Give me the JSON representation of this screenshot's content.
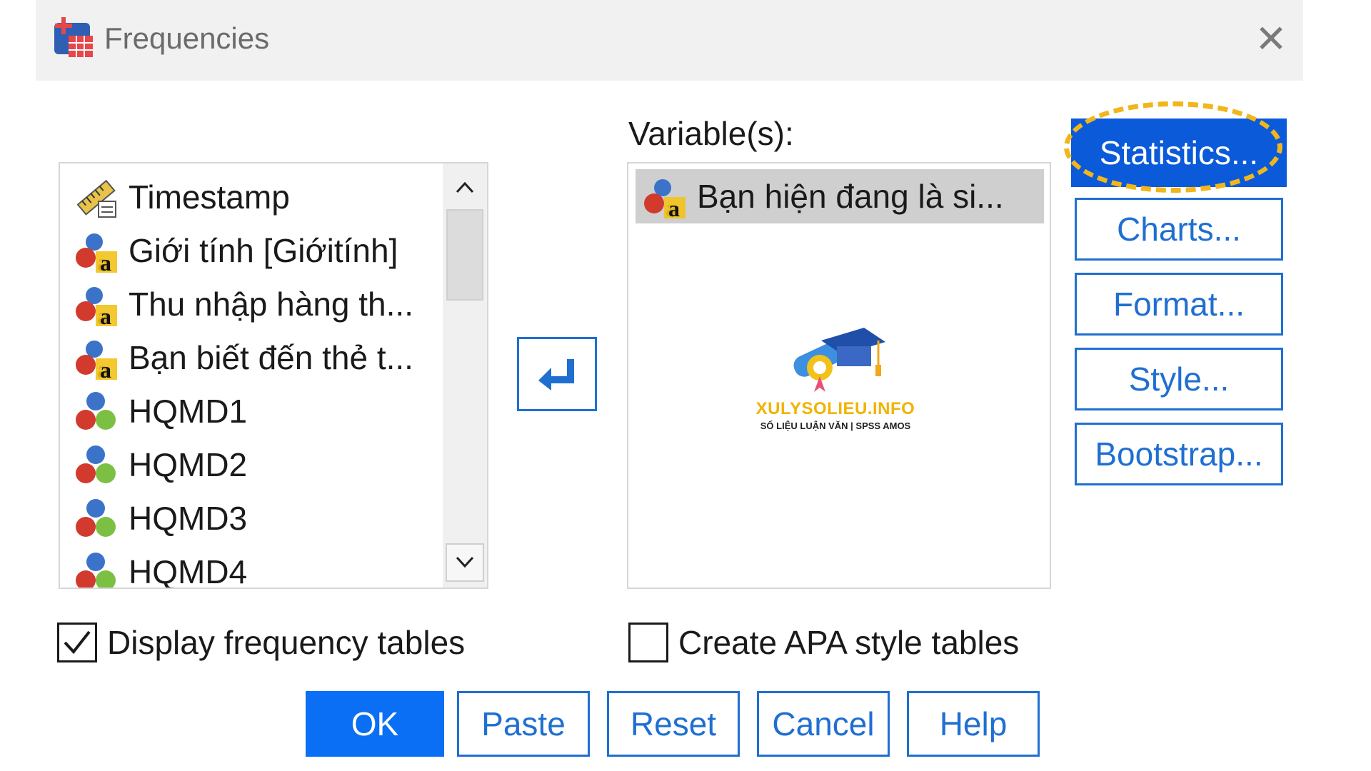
{
  "window": {
    "title": "Frequencies",
    "close_label": "✕"
  },
  "source_list": {
    "items": [
      {
        "label": "Timestamp",
        "icon": "ruler-scale-icon"
      },
      {
        "label": "Giới tính [Giớitính]",
        "icon": "nominal-string-icon"
      },
      {
        "label": "Thu nhập hàng th...",
        "icon": "nominal-string-icon"
      },
      {
        "label": "Bạn biết đến thẻ t...",
        "icon": "nominal-string-icon"
      },
      {
        "label": "HQMD1",
        "icon": "nominal-numeric-icon"
      },
      {
        "label": "HQMD2",
        "icon": "nominal-numeric-icon"
      },
      {
        "label": "HQMD3",
        "icon": "nominal-numeric-icon"
      },
      {
        "label": "HQMD4",
        "icon": "nominal-numeric-icon"
      }
    ]
  },
  "variables": {
    "label": "Variable(s):",
    "items": [
      {
        "label": "Bạn hiện đang là si...",
        "icon": "nominal-string-icon"
      }
    ]
  },
  "watermark": {
    "title": "XULYSOLIEU.INFO",
    "subtitle": "SỐ LIỆU LUẬN VĂN | SPSS AMOS"
  },
  "side_buttons": {
    "statistics": "Statistics...",
    "charts": "Charts...",
    "format": "Format...",
    "style": "Style...",
    "bootstrap": "Bootstrap..."
  },
  "options": {
    "display_frequency_tables": {
      "label": "Display frequency tables",
      "checked": true
    },
    "create_apa_tables": {
      "label": "Create APA style tables",
      "checked": false
    }
  },
  "bottom_buttons": {
    "ok": "OK",
    "paste": "Paste",
    "reset": "Reset",
    "cancel": "Cancel",
    "help": "Help"
  },
  "colors": {
    "accent": "#1f6fd1",
    "primary_fill": "#0a6ff5",
    "highlight_ring": "#f2b61c",
    "selected_row": "#cfcfcf"
  }
}
